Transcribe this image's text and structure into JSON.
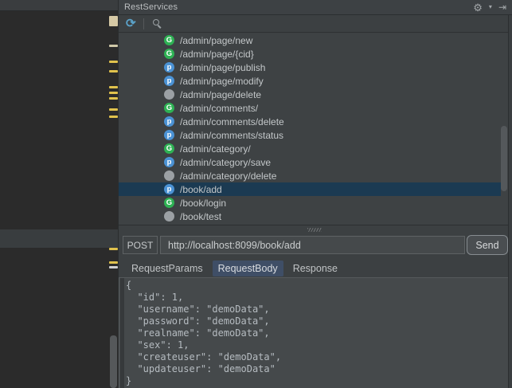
{
  "window": {
    "title": "RestServices"
  },
  "icons": {
    "gear": "⚙",
    "gear_caret": "▾",
    "hide": "⇥",
    "refresh": "⟳"
  },
  "endpoints": {
    "method_letters": {
      "GET": "G",
      "POST": "p",
      "DELETE": ""
    },
    "method_colors": {
      "GET": "#2eb254",
      "POST": "#4b92d4",
      "DELETE": "#9ba0a4"
    },
    "items": [
      {
        "method": "GET",
        "path": "/admin/page/new",
        "selected": false
      },
      {
        "method": "GET",
        "path": "/admin/page/{cid}",
        "selected": false
      },
      {
        "method": "POST",
        "path": "/admin/page/publish",
        "selected": false
      },
      {
        "method": "POST",
        "path": "/admin/page/modify",
        "selected": false
      },
      {
        "method": "DELETE",
        "path": "/admin/page/delete",
        "selected": false
      },
      {
        "method": "GET",
        "path": "/admin/comments/",
        "selected": false
      },
      {
        "method": "POST",
        "path": "/admin/comments/delete",
        "selected": false
      },
      {
        "method": "POST",
        "path": "/admin/comments/status",
        "selected": false
      },
      {
        "method": "GET",
        "path": "/admin/category/",
        "selected": false
      },
      {
        "method": "POST",
        "path": "/admin/category/save",
        "selected": false
      },
      {
        "method": "DELETE",
        "path": "/admin/category/delete",
        "selected": false
      },
      {
        "method": "POST",
        "path": "/book/add",
        "selected": true
      },
      {
        "method": "GET",
        "path": "/book/login",
        "selected": false
      },
      {
        "method": "DELETE",
        "path": "/book/test",
        "selected": false
      }
    ]
  },
  "request": {
    "method": "POST",
    "url": "http://localhost:8099/book/add",
    "send_label": "Send"
  },
  "tabs": [
    {
      "label": "RequestParams",
      "selected": false
    },
    {
      "label": "RequestBody",
      "selected": true
    },
    {
      "label": "Response",
      "selected": false
    }
  ],
  "request_body": {
    "lines": [
      "{",
      "  \"id\": 1,",
      "  \"username\": \"demoData\",",
      "  \"password\": \"demoData\",",
      "  \"realname\": \"demoData\",",
      "  \"sex\": 1,",
      "  \"createuser\": \"demoData\",",
      "  \"updateuser\": \"demoData\"",
      "}"
    ]
  },
  "colors": {
    "selection_row": "#1b3a52",
    "selected_tab": "#3f4e66",
    "panel_bg": "#3c4042",
    "editor_bg": "#2b2b2b",
    "body_editor_bg": "#45494b",
    "get_icon": "#2eb254",
    "post_icon": "#4b92d4",
    "delete_icon": "#9ba0a4",
    "marker_yellow": "#e0c24d"
  }
}
